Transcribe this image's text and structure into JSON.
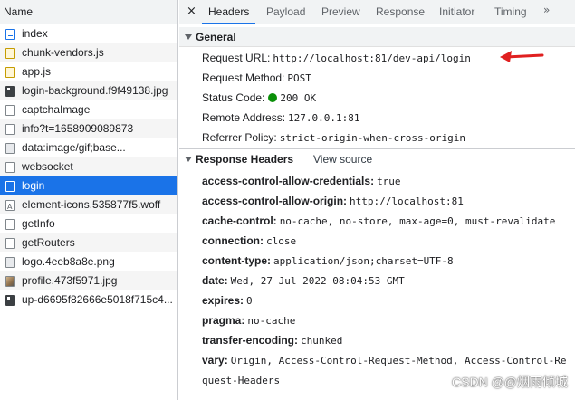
{
  "left": {
    "header": "Name",
    "requests": [
      {
        "name": "index",
        "icon": "document-icon"
      },
      {
        "name": "chunk-vendors.js",
        "icon": "script-icon"
      },
      {
        "name": "app.js",
        "icon": "script-icon"
      },
      {
        "name": "login-background.f9f49138.jpg",
        "icon": "image-icon"
      },
      {
        "name": "captchaImage",
        "icon": "file-icon"
      },
      {
        "name": "info?t=1658909089873",
        "icon": "file-icon"
      },
      {
        "name": "data:image/gif;base...",
        "icon": "image-icon"
      },
      {
        "name": "websocket",
        "icon": "file-icon"
      },
      {
        "name": "login",
        "icon": "file-icon"
      },
      {
        "name": "element-icons.535877f5.woff",
        "icon": "font-icon"
      },
      {
        "name": "getInfo",
        "icon": "file-icon"
      },
      {
        "name": "getRouters",
        "icon": "file-icon"
      },
      {
        "name": "logo.4eeb8a8e.png",
        "icon": "image-icon"
      },
      {
        "name": "profile.473f5971.jpg",
        "icon": "image-icon"
      },
      {
        "name": "up-d6695f82666e5018f715c4...",
        "icon": "image-icon"
      }
    ],
    "selected": "login"
  },
  "tabs": {
    "close": "×",
    "items": [
      "Headers",
      "Payload",
      "Preview",
      "Response",
      "Initiator",
      "Timing"
    ],
    "active": "Headers",
    "more": "»"
  },
  "general": {
    "title": "General",
    "request_url_key": "Request URL:",
    "request_url": "http://localhost:81/dev-api/login",
    "request_method_key": "Request Method:",
    "request_method": "POST",
    "status_code_key": "Status Code:",
    "status_code": "200 OK",
    "remote_address_key": "Remote Address:",
    "remote_address": "127.0.0.1:81",
    "referrer_policy_key": "Referrer Policy:",
    "referrer_policy": "strict-origin-when-cross-origin",
    "status_color": "#0a8f08",
    "arrow_color": "#e02020"
  },
  "response_headers": {
    "title": "Response Headers",
    "view_source": "View source",
    "items": [
      {
        "key": "access-control-allow-credentials:",
        "value": "true"
      },
      {
        "key": "access-control-allow-origin:",
        "value": "http://localhost:81"
      },
      {
        "key": "cache-control:",
        "value": "no-cache, no-store, max-age=0, must-revalidate"
      },
      {
        "key": "connection:",
        "value": "close"
      },
      {
        "key": "content-type:",
        "value": "application/json;charset=UTF-8"
      },
      {
        "key": "date:",
        "value": "Wed, 27 Jul 2022 08:04:53 GMT"
      },
      {
        "key": "expires:",
        "value": "0"
      },
      {
        "key": "pragma:",
        "value": "no-cache"
      },
      {
        "key": "transfer-encoding:",
        "value": "chunked"
      },
      {
        "key": "vary:",
        "value": "Origin, Access-Control-Request-Method, Access-Control-Re"
      }
    ],
    "vary_wrap": "quest-Headers"
  },
  "watermark": "CSDN @@烟雨倾城"
}
